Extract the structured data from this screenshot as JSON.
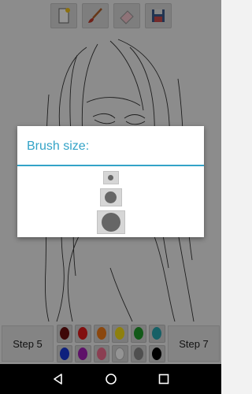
{
  "toolbar": {
    "tools": [
      {
        "icon": "new-page-icon"
      },
      {
        "icon": "brush-icon"
      },
      {
        "icon": "eraser-icon"
      },
      {
        "icon": "save-icon"
      }
    ]
  },
  "dialog": {
    "title": "Brush size:",
    "sizes": [
      "small",
      "medium",
      "large"
    ],
    "accent": "#33a3c7"
  },
  "bottom": {
    "prev_step": "Step 5",
    "next_step": "Step 7",
    "palette": [
      "#6b0f0f",
      "#e01b1b",
      "#f07a19",
      "#f5dc17",
      "#1f9a2a",
      "#27a6b0",
      "#1838d8",
      "#a21fb5",
      "#ef6d8e",
      "#ffffff",
      "#888888",
      "#000000"
    ]
  },
  "navbar": {
    "buttons": [
      "back-icon",
      "home-icon",
      "recents-icon"
    ]
  }
}
